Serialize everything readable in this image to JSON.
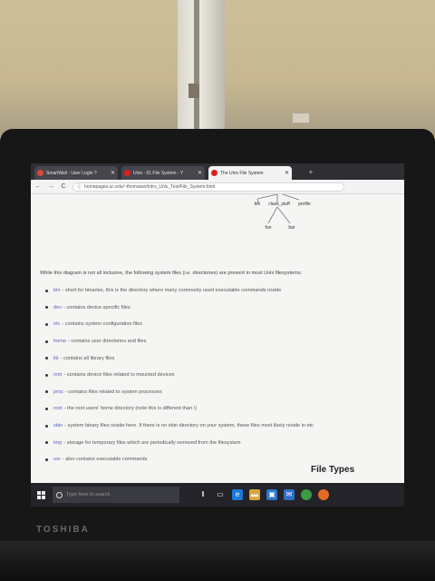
{
  "browser": {
    "tabs": [
      {
        "title": "SmartWall - User Login ?",
        "fav_color": "#d94a38"
      },
      {
        "title": "Unix - 01 File System - Y",
        "fav_color": "#e02020"
      },
      {
        "title": "The Unix File System",
        "fav_color": "#e02020"
      }
    ],
    "new_tab": "+",
    "nav": {
      "back": "←",
      "forward": "→",
      "reload": "C"
    },
    "url": "homepages.uc.edu/~thomaswr/intro_Unix_Text/File_System.html"
  },
  "tree": {
    "nodes": [
      "bin",
      "class_stuff",
      "profile",
      "foo",
      "bar"
    ]
  },
  "page": {
    "intro": "While this diagram is not all inclusive, the following system files (i.e. directories) are present in most Unix filesystems:",
    "items": [
      {
        "name": "bin",
        "desc": " - short for binaries, this is the directory where many commonly used executable commands reside"
      },
      {
        "name": "dev",
        "desc": " - contains device specific files"
      },
      {
        "name": "etc",
        "desc": " - contains system configuration files"
      },
      {
        "name": "home",
        "desc": " - contains user directories and files"
      },
      {
        "name": "lib",
        "desc": " - contains all library files"
      },
      {
        "name": "mnt",
        "desc": " - contains device files related to mounted devices"
      },
      {
        "name": "proc",
        "desc": " - contains files related to system processes"
      },
      {
        "name": "root",
        "desc": " - the root users' home directory (note this is different than /)"
      },
      {
        "name": "sbin",
        "desc": " - system binary files reside here. If there is no sbin directory on your system, these files most likely reside in etc"
      },
      {
        "name": "tmp",
        "desc": " - storage for temporary files which are periodically removed from the filesystem"
      },
      {
        "name": "usr",
        "desc": " - also contains executable commands"
      }
    ],
    "section_heading": "File Types"
  },
  "taskbar": {
    "search_placeholder": "Type here to search",
    "icons": [
      {
        "name": "mic-icon",
        "glyph": "🎙",
        "color": "#232329"
      },
      {
        "name": "task-view-icon",
        "glyph": "▭",
        "color": "#232329"
      },
      {
        "name": "edge-icon",
        "glyph": "e",
        "color": "#1c7ad8"
      },
      {
        "name": "file-explorer-icon",
        "glyph": "▬",
        "color": "#d8a63a"
      },
      {
        "name": "store-icon",
        "glyph": "▣",
        "color": "#2a77c9"
      },
      {
        "name": "mail-icon",
        "glyph": "✉",
        "color": "#2f6fc4"
      },
      {
        "name": "chrome-icon",
        "glyph": "●",
        "color": "#3c9b44"
      },
      {
        "name": "firefox-icon",
        "glyph": "●",
        "color": "#e46a24"
      }
    ]
  },
  "laptop": {
    "brand": "TOSHIBA"
  }
}
